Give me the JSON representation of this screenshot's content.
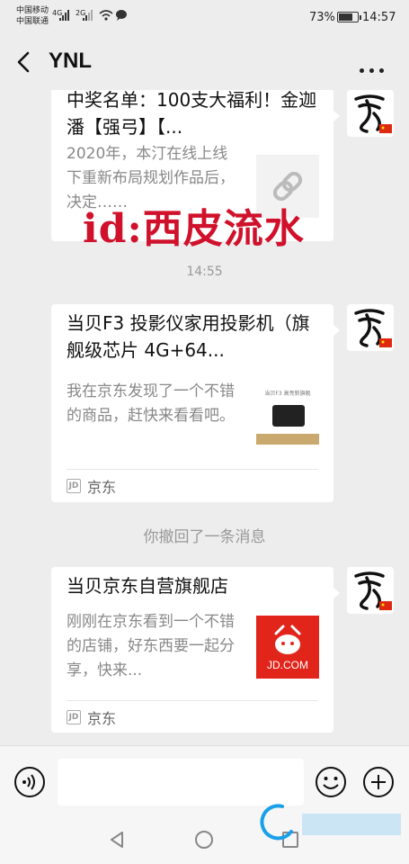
{
  "status_bar": {
    "carrier1": "中国移动",
    "carrier2": "中国联通",
    "net1": "4G",
    "net2": "2G",
    "battery": "73%",
    "time": "14:57"
  },
  "nav": {
    "title": "YNL"
  },
  "messages": [
    {
      "title": "中奖名单：100支大福利！金迦潘【强弓】【...",
      "desc": "2020年，本汀在线上线下重新布局规划作品后，决定……",
      "thumb": "link-icon"
    },
    {
      "time": "14:55"
    },
    {
      "title": "当贝F3 投影仪家用投影机（旗舰级芯片 4G+64...",
      "desc": "我在京东发现了一个不错的商品，赶快来看看吧。",
      "footer": "京东",
      "thumb_caption": "当贝F3 高亮新旗舰"
    },
    {
      "recall": "你撤回了一条消息"
    },
    {
      "title": "当贝京东自营旗舰店",
      "desc": "刚刚在京东看到一个不错的店铺，好东西要一起分享，快来...",
      "footer": "京东",
      "thumb_text": "JD.COM"
    }
  ],
  "watermark": "id:西皮流水",
  "jd_mark": "JD",
  "colors": {
    "background": "#ededed",
    "bubble": "#ffffff",
    "jd_red": "#e1251b",
    "watermark": "#d0112b"
  }
}
